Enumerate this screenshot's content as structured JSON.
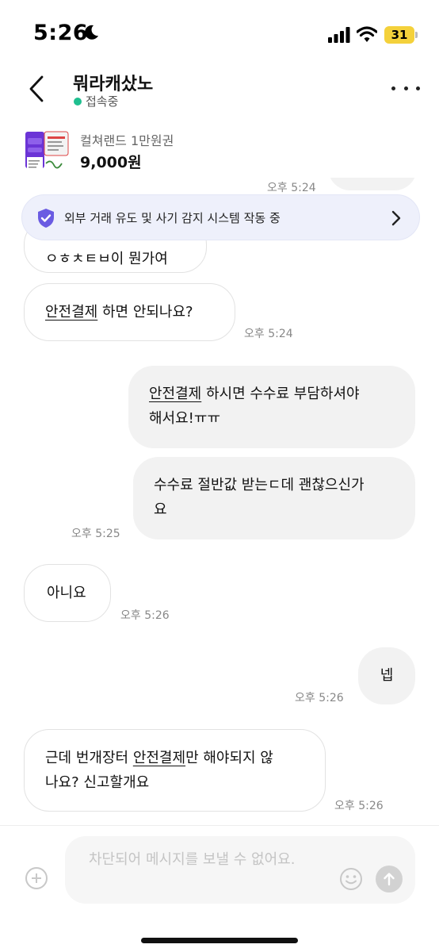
{
  "status_bar": {
    "time": "5:26",
    "battery": "31"
  },
  "header": {
    "title": "뭐라캐샀노",
    "status": "접속중"
  },
  "product": {
    "name": "컬쳐랜드 1만원권",
    "price": "9,000원"
  },
  "banner": {
    "text": "외부 거래 유도 및 사기 감지 시스템 작동 중"
  },
  "messages": {
    "partial_ts": "오후 5:24",
    "m1": {
      "text": "ㅇㅎㅊㅌㅂ이 뭔가여"
    },
    "m2": {
      "link": "안전결제",
      "text": " 하면 안되나요?",
      "time": "오후 5:24"
    },
    "m3": {
      "link": "안전결제",
      "line1": " 하시면 수수료 부담하셔야",
      "line2": "해서요!ㅠㅠ"
    },
    "m4": {
      "line1": "수수료 절반값 받는ㄷ데 괜찮으신가",
      "line2": "요",
      "time": "오후 5:25"
    },
    "m5": {
      "text": "아니요",
      "time": "오후 5:26"
    },
    "m6": {
      "text": "넵",
      "time": "오후 5:26"
    },
    "m7": {
      "pre": "근데 번개장터 ",
      "link": "안전결제",
      "post": "만 해야되지 않",
      "line2": "나요? 신고할개요",
      "time": "오후 5:26"
    }
  },
  "input": {
    "placeholder": "차단되어 메시지를 보낼 수 없어요."
  },
  "colors": {
    "online": "#1fbf8f",
    "banner_bg": "#eef0fb",
    "shield": "#6a5be2",
    "battery": "#f4d13b"
  },
  "icons": [
    "moon-icon",
    "signal-icon",
    "wifi-icon",
    "back-arrow-icon",
    "more-icon",
    "shield-check-icon",
    "chevron-right-icon",
    "plus-icon",
    "emoji-icon",
    "send-arrow-icon"
  ]
}
